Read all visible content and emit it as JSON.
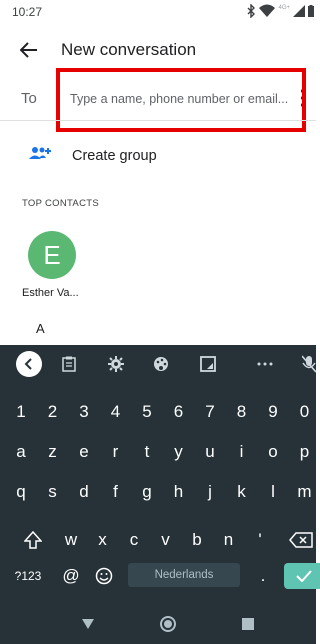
{
  "status_bar": {
    "time": "10:27",
    "network": "4G+"
  },
  "header": {
    "title": "New conversation"
  },
  "to_field": {
    "label": "To",
    "placeholder": "Type a name, phone number or email..."
  },
  "create_group": {
    "label": "Create group"
  },
  "top_contacts": {
    "header": "TOP CONTACTS",
    "contacts": [
      {
        "initial": "E",
        "name": "Esther Va...",
        "color": "#5ab872"
      }
    ]
  },
  "alpha_header": "A",
  "keyboard": {
    "number_row": [
      "1",
      "2",
      "3",
      "4",
      "5",
      "6",
      "7",
      "8",
      "9",
      "0"
    ],
    "row1": [
      "a",
      "z",
      "e",
      "r",
      "t",
      "y",
      "u",
      "i",
      "o",
      "p"
    ],
    "row2": [
      "q",
      "s",
      "d",
      "f",
      "g",
      "h",
      "j",
      "k",
      "l",
      "m"
    ],
    "row3": [
      "w",
      "x",
      "c",
      "v",
      "b",
      "n",
      "'"
    ],
    "symbols_label": "?123",
    "at_key": "@",
    "period_key": ".",
    "spacebar_label": "Nederlands"
  },
  "colors": {
    "keyboard_bg": "#263238",
    "accent": "#1a73e8",
    "avatar": "#5ab872",
    "enter": "#5fc4b2",
    "highlight": "#e60000"
  }
}
